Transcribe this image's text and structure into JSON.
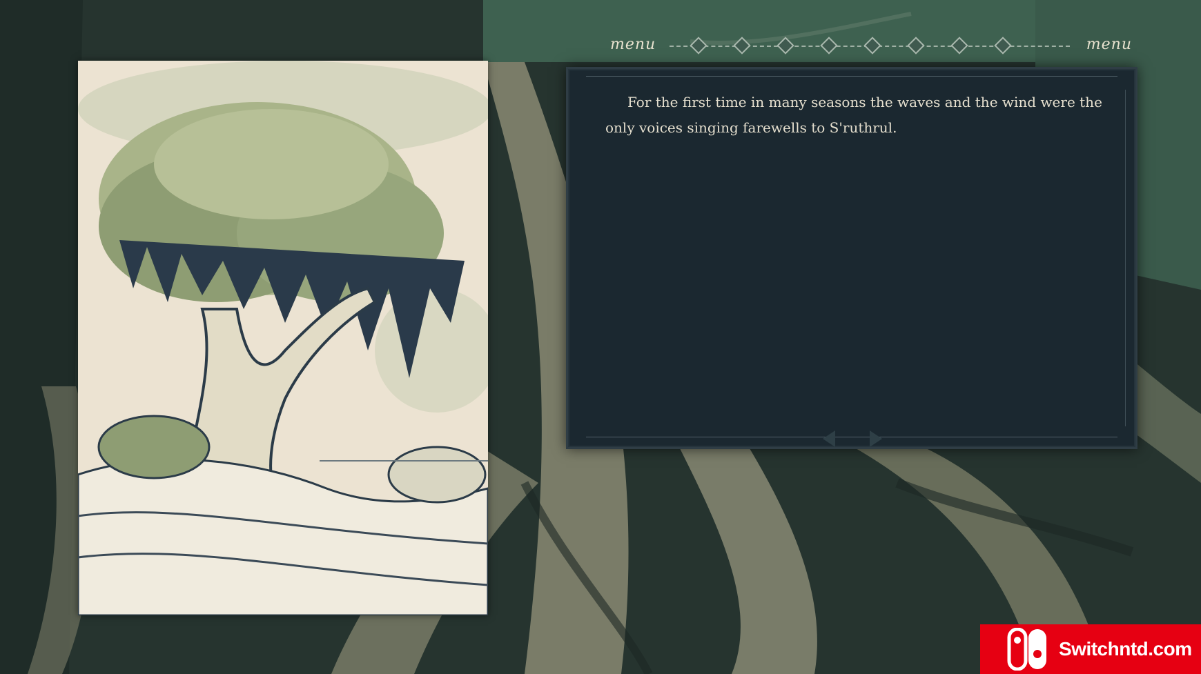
{
  "menu": {
    "left_label": "menu",
    "right_label": "menu",
    "progress_markers": 8
  },
  "story": {
    "text": "For the first time in many seasons the waves and the wind were the only voices singing farewells to S'ruthrul."
  },
  "illustration": {
    "subject": "tree-on-cliff-illustration"
  },
  "watermark": {
    "text": "Switchntd.com"
  },
  "colors": {
    "background": "#24332f",
    "panel": "#1b2830",
    "text": "#e6e0cf",
    "watermark": "#e60012"
  }
}
